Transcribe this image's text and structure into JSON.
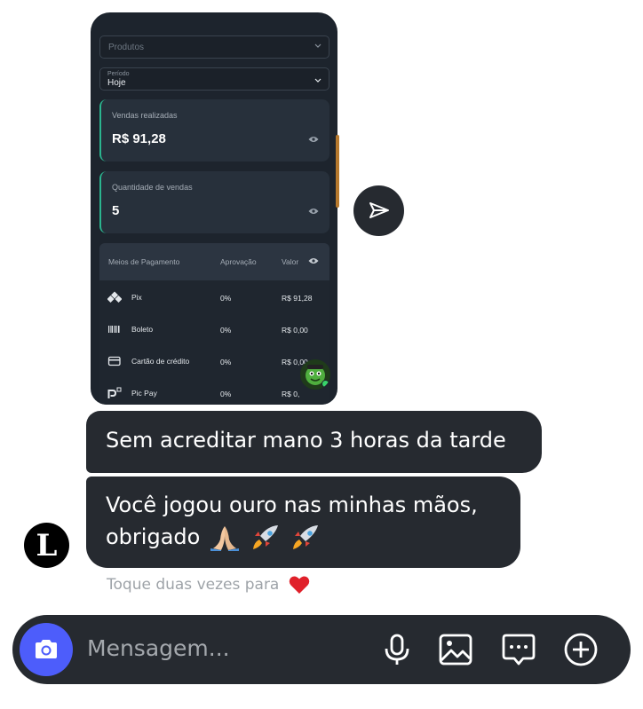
{
  "dashboard": {
    "products_placeholder": "Produtos",
    "period_label": "Período",
    "period_value": "Hoje",
    "sales_done_label": "Vendas realizadas",
    "sales_done_value": "R$ 91,28",
    "sales_count_label": "Quantidade de vendas",
    "sales_count_value": "5",
    "accent_color": "#2bb58f",
    "payments": {
      "headers": [
        "Meios de Pagamento",
        "Aprovação",
        "Valor"
      ],
      "rows": [
        {
          "icon": "pix-icon",
          "name": "Pix",
          "approval": "0%",
          "value": "R$ 91,28"
        },
        {
          "icon": "barcode-icon",
          "name": "Boleto",
          "approval": "0%",
          "value": "R$ 0,00"
        },
        {
          "icon": "credit-card-icon",
          "name": "Cartão de crédito",
          "approval": "0%",
          "value": "R$ 0,00"
        },
        {
          "icon": "picpay-icon",
          "name": "Pic Pay",
          "approval": "0%",
          "value": "R$ 0,"
        }
      ]
    }
  },
  "messages": [
    {
      "text": "Sem acreditar mano 3 horas da tarde"
    },
    {
      "line1": "Você jogou ouro nas minhas mãos,",
      "line2": "obrigado"
    }
  ],
  "sender_avatar_letter": "L",
  "double_tap_hint": "Toque duas vezes para",
  "composer": {
    "placeholder": "Mensagem...",
    "camera_color": "#4d5dfb",
    "icons": [
      "camera-icon",
      "microphone-icon",
      "gallery-icon",
      "sticker-icon",
      "plus-icon"
    ]
  }
}
